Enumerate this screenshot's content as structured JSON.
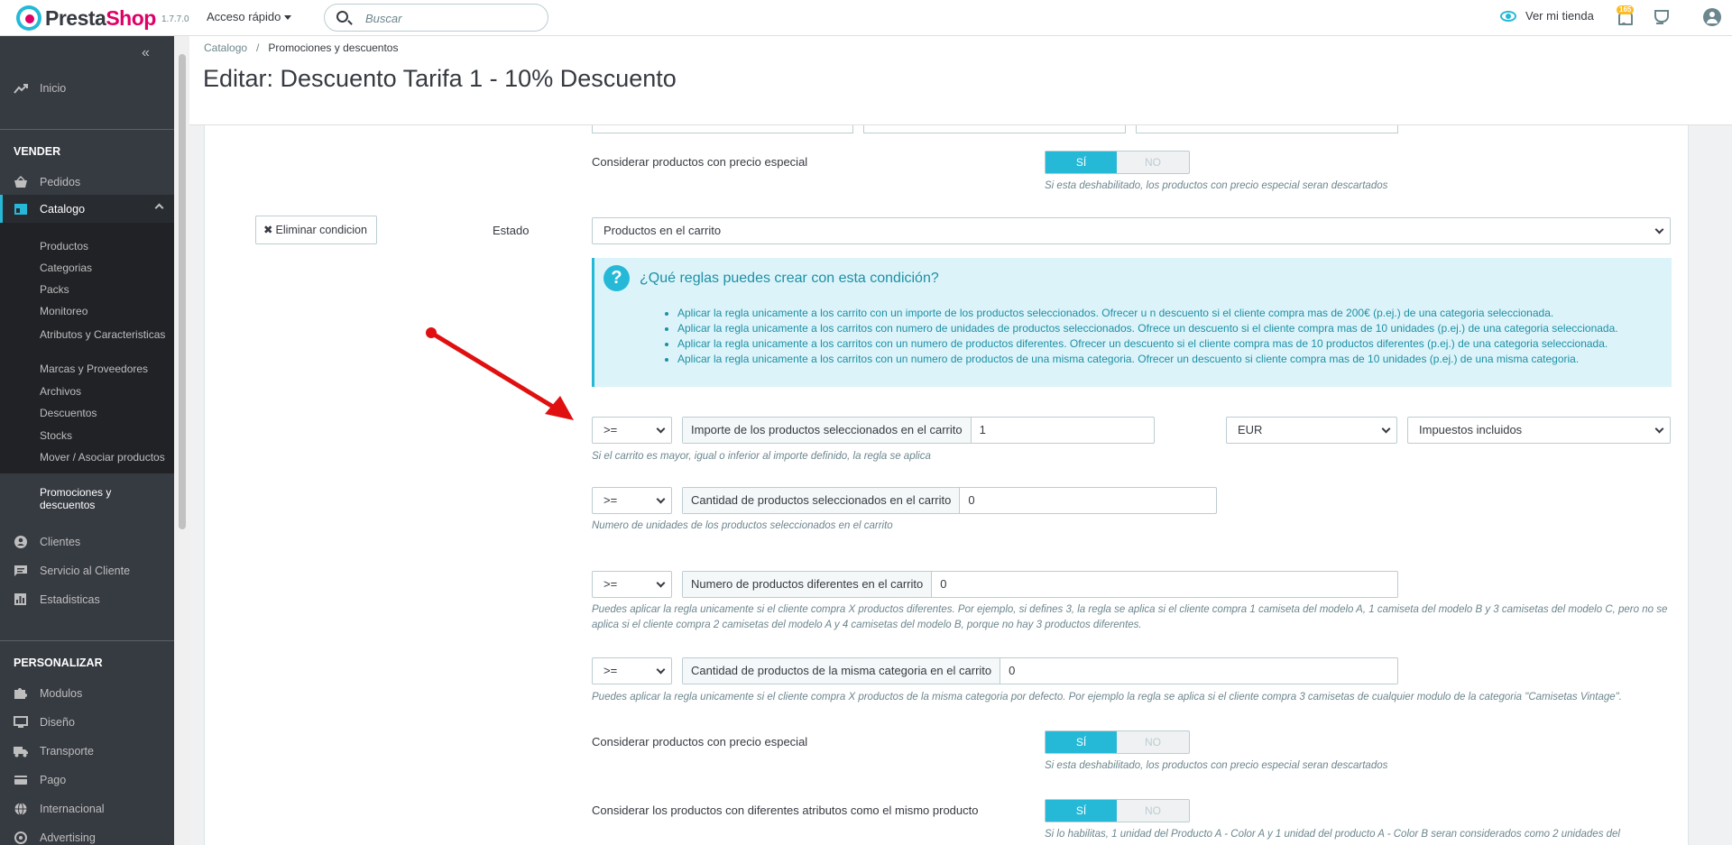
{
  "header": {
    "logo_prefix": "Presta",
    "logo_suffix": "Shop",
    "version": "1.7.7.0",
    "quick_access": "Acceso rápido",
    "search_placeholder": "Buscar",
    "view_store": "Ver mi tienda",
    "notifications_count": "165"
  },
  "sidebar": {
    "home": "Inicio",
    "sell_section": "VENDER",
    "orders": "Pedidos",
    "catalog": "Catalogo",
    "catalog_sub": [
      "Productos",
      "Categorias",
      "Packs",
      "Monitoreo",
      "Atributos y Caracteristicas",
      "Marcas y Proveedores",
      "Archivos",
      "Descuentos",
      "Stocks",
      "Mover / Asociar productos",
      "Promociones y descuentos"
    ],
    "customers": "Clientes",
    "customer_service": "Servicio al Cliente",
    "stats": "Estadisticas",
    "customize_section": "PERSONALIZAR",
    "modules": "Modulos",
    "design": "Diseño",
    "shipping": "Transporte",
    "payment": "Pago",
    "international": "Internacional",
    "advertising": "Advertising"
  },
  "breadcrumb": {
    "parent": "Catalogo",
    "separator": "/",
    "current": "Promociones y descuentos"
  },
  "page_title": "Editar: Descuento Tarifa 1 - 10% Descuento",
  "content": {
    "special_price_label": "Considerar productos con precio especial",
    "yes": "SÍ",
    "no": "NO",
    "special_price_help": "Si esta deshabilitado, los productos con precio especial seran descartados",
    "delete_condition": "Eliminar condicion",
    "state_label": "Estado",
    "state_select": "Productos en el carrito",
    "info_title": "¿Qué reglas puedes crear con esta condición?",
    "info_items": [
      "Aplicar la regla unicamente a los carrito con un importe de los productos seleccionados. Ofrecer u n descuento si el cliente compra mas de 200€ (p.ej.) de una categoria seleccionada.",
      "Aplicar la regla unicamente a los carritos con numero de unidades de productos seleccionados. Ofrece un descuento si el cliente compra mas de 10 unidades (p.ej.) de una categoria seleccionada.",
      "Aplicar la regla unicamente a los carritos con un numero de productos diferentes. Ofrecer un descuento si el cliente compra mas de 10 productos diferentes (p.ej.) de una categoria seleccionada.",
      "Aplicar la regla unicamente a los carritos con un numero de productos de una misma categoria. Ofrecer un descuento si cliente compra mas de 10 unidades (p.ej.) de una misma categoria."
    ],
    "operator": ">=",
    "amount_label": "Importe de los productos seleccionados en el carrito",
    "amount_value": "1",
    "currency": "EUR",
    "tax": "Impuestos incluidos",
    "amount_help": "Si el carrito es mayor, igual o inferior al importe definido, la regla se aplica",
    "qty_label": "Cantidad de productos seleccionados en el carrito",
    "qty_value": "0",
    "qty_help": "Numero de unidades de los productos seleccionados en el carrito",
    "diff_label": "Numero de productos diferentes en el carrito",
    "diff_value": "0",
    "diff_help": "Puedes aplicar la regla unicamente si el cliente compra X productos diferentes. Por ejemplo, si defines 3, la regla se aplica si el cliente compra 1 camiseta del modelo A, 1 camiseta del modelo B y 3 camisetas del modelo C, pero no se aplica si el cliente compra 2 camisetas del modelo A y 4 camisetas del modelo B, porque no hay 3 productos diferentes.",
    "samecat_label": "Cantidad de productos de la misma categoria en el carrito",
    "samecat_value": "0",
    "samecat_help": "Puedes aplicar la regla unicamente si el cliente compra X productos de la misma categoria por defecto. Por ejemplo la regla se aplica si el cliente compra 3 camisetas de cualquier modulo de la categoria \"Camisetas Vintage\".",
    "attr_label": "Considerar los productos con diferentes atributos como el mismo producto",
    "attr_help": "Si lo habilitas, 1 unidad del Producto A - Color A y 1 unidad del producto A - Color B seran considerados como 2 unidades del"
  },
  "colors": {
    "accent": "#25b9d7",
    "brand": "#df0067",
    "sidebar_bg": "#363a41",
    "arrow": "#e01010"
  }
}
